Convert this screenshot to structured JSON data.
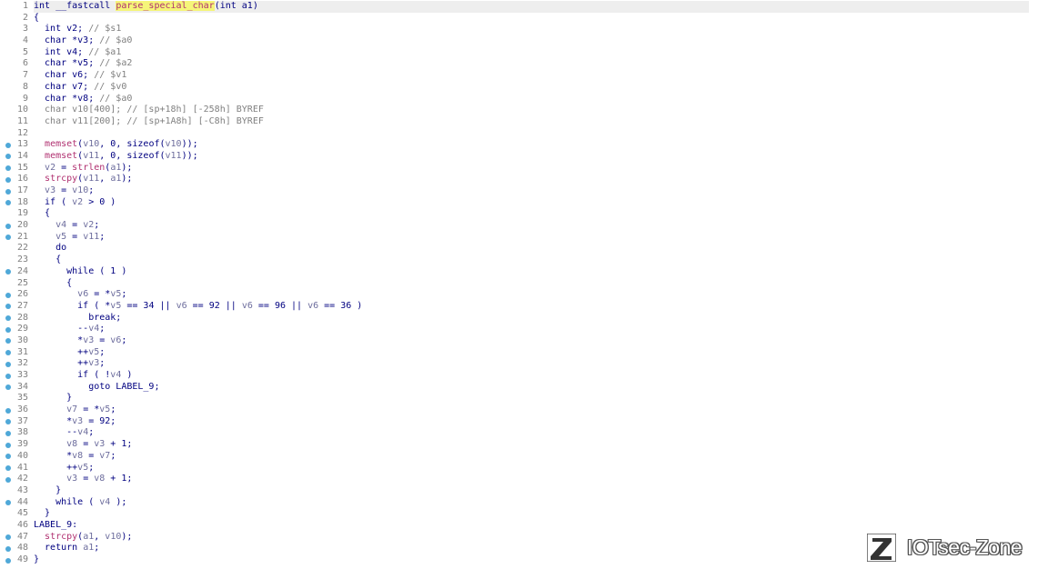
{
  "editor": {
    "lines": [
      {
        "n": "1",
        "bp": false,
        "hl": true,
        "tokens": [
          [
            "plain",
            "int __fastcall "
          ],
          [
            "hlfn",
            "parse_special_char"
          ],
          [
            "plain",
            "(int a1)"
          ]
        ]
      },
      {
        "n": "2",
        "bp": false,
        "tokens": [
          [
            "plain",
            "{"
          ]
        ]
      },
      {
        "n": "3",
        "bp": false,
        "tokens": [
          [
            "plain",
            "  int v2; "
          ],
          [
            "comment",
            "// $s1"
          ]
        ]
      },
      {
        "n": "4",
        "bp": false,
        "tokens": [
          [
            "plain",
            "  char *v3; "
          ],
          [
            "comment",
            "// $a0"
          ]
        ]
      },
      {
        "n": "5",
        "bp": false,
        "tokens": [
          [
            "plain",
            "  int v4; "
          ],
          [
            "comment",
            "// $a1"
          ]
        ]
      },
      {
        "n": "6",
        "bp": false,
        "tokens": [
          [
            "plain",
            "  char *v5; "
          ],
          [
            "comment",
            "// $a2"
          ]
        ]
      },
      {
        "n": "7",
        "bp": false,
        "tokens": [
          [
            "plain",
            "  char v6; "
          ],
          [
            "comment",
            "// $v1"
          ]
        ]
      },
      {
        "n": "8",
        "bp": false,
        "tokens": [
          [
            "plain",
            "  char v7; "
          ],
          [
            "comment",
            "// $v0"
          ]
        ]
      },
      {
        "n": "9",
        "bp": false,
        "tokens": [
          [
            "plain",
            "  char *v8; "
          ],
          [
            "comment",
            "// $a0"
          ]
        ]
      },
      {
        "n": "10",
        "bp": false,
        "tokens": [
          [
            "comment",
            "  char v10[400]; // [sp+18h] [-258h] BYREF"
          ]
        ]
      },
      {
        "n": "11",
        "bp": false,
        "tokens": [
          [
            "comment",
            "  char v11[200]; // [sp+1A8h] [-C8h] BYREF"
          ]
        ]
      },
      {
        "n": "12",
        "bp": false,
        "tokens": [
          [
            "plain",
            ""
          ]
        ]
      },
      {
        "n": "13",
        "bp": true,
        "tokens": [
          [
            "plain",
            "  "
          ],
          [
            "fn",
            "memset"
          ],
          [
            "plain",
            "("
          ],
          [
            "var",
            "v10"
          ],
          [
            "plain",
            ", 0, sizeof("
          ],
          [
            "var",
            "v10"
          ],
          [
            "plain",
            "));"
          ]
        ]
      },
      {
        "n": "14",
        "bp": true,
        "tokens": [
          [
            "plain",
            "  "
          ],
          [
            "fn",
            "memset"
          ],
          [
            "plain",
            "("
          ],
          [
            "var",
            "v11"
          ],
          [
            "plain",
            ", 0, sizeof("
          ],
          [
            "var",
            "v11"
          ],
          [
            "plain",
            "));"
          ]
        ]
      },
      {
        "n": "15",
        "bp": true,
        "tokens": [
          [
            "plain",
            "  "
          ],
          [
            "var",
            "v2"
          ],
          [
            "plain",
            " = "
          ],
          [
            "fn",
            "strlen"
          ],
          [
            "plain",
            "("
          ],
          [
            "var",
            "a1"
          ],
          [
            "plain",
            ");"
          ]
        ]
      },
      {
        "n": "16",
        "bp": true,
        "tokens": [
          [
            "plain",
            "  "
          ],
          [
            "fn",
            "strcpy"
          ],
          [
            "plain",
            "("
          ],
          [
            "var",
            "v11"
          ],
          [
            "plain",
            ", "
          ],
          [
            "var",
            "a1"
          ],
          [
            "plain",
            ");"
          ]
        ]
      },
      {
        "n": "17",
        "bp": true,
        "tokens": [
          [
            "plain",
            "  "
          ],
          [
            "var",
            "v3"
          ],
          [
            "plain",
            " = "
          ],
          [
            "var",
            "v10"
          ],
          [
            "plain",
            ";"
          ]
        ]
      },
      {
        "n": "18",
        "bp": true,
        "tokens": [
          [
            "plain",
            "  if ( "
          ],
          [
            "var",
            "v2"
          ],
          [
            "plain",
            " > 0 )"
          ]
        ]
      },
      {
        "n": "19",
        "bp": false,
        "tokens": [
          [
            "plain",
            "  {"
          ]
        ]
      },
      {
        "n": "20",
        "bp": true,
        "tokens": [
          [
            "plain",
            "    "
          ],
          [
            "var",
            "v4"
          ],
          [
            "plain",
            " = "
          ],
          [
            "var",
            "v2"
          ],
          [
            "plain",
            ";"
          ]
        ]
      },
      {
        "n": "21",
        "bp": true,
        "tokens": [
          [
            "plain",
            "    "
          ],
          [
            "var",
            "v5"
          ],
          [
            "plain",
            " = "
          ],
          [
            "var",
            "v11"
          ],
          [
            "plain",
            ";"
          ]
        ]
      },
      {
        "n": "22",
        "bp": false,
        "tokens": [
          [
            "plain",
            "    do"
          ]
        ]
      },
      {
        "n": "23",
        "bp": false,
        "tokens": [
          [
            "plain",
            "    {"
          ]
        ]
      },
      {
        "n": "24",
        "bp": true,
        "tokens": [
          [
            "plain",
            "      while ( 1 )"
          ]
        ]
      },
      {
        "n": "25",
        "bp": false,
        "tokens": [
          [
            "plain",
            "      {"
          ]
        ]
      },
      {
        "n": "26",
        "bp": true,
        "tokens": [
          [
            "plain",
            "        "
          ],
          [
            "var",
            "v6"
          ],
          [
            "plain",
            " = *"
          ],
          [
            "var",
            "v5"
          ],
          [
            "plain",
            ";"
          ]
        ]
      },
      {
        "n": "27",
        "bp": true,
        "tokens": [
          [
            "plain",
            "        if ( *"
          ],
          [
            "var",
            "v5"
          ],
          [
            "plain",
            " == 34 || "
          ],
          [
            "var",
            "v6"
          ],
          [
            "plain",
            " == 92 || "
          ],
          [
            "var",
            "v6"
          ],
          [
            "plain",
            " == 96 || "
          ],
          [
            "var",
            "v6"
          ],
          [
            "plain",
            " == 36 )"
          ]
        ]
      },
      {
        "n": "28",
        "bp": true,
        "tokens": [
          [
            "plain",
            "          break;"
          ]
        ]
      },
      {
        "n": "29",
        "bp": true,
        "tokens": [
          [
            "plain",
            "        --"
          ],
          [
            "var",
            "v4"
          ],
          [
            "plain",
            ";"
          ]
        ]
      },
      {
        "n": "30",
        "bp": true,
        "tokens": [
          [
            "plain",
            "        *"
          ],
          [
            "var",
            "v3"
          ],
          [
            "plain",
            " = "
          ],
          [
            "var",
            "v6"
          ],
          [
            "plain",
            ";"
          ]
        ]
      },
      {
        "n": "31",
        "bp": true,
        "tokens": [
          [
            "plain",
            "        ++"
          ],
          [
            "var",
            "v5"
          ],
          [
            "plain",
            ";"
          ]
        ]
      },
      {
        "n": "32",
        "bp": true,
        "tokens": [
          [
            "plain",
            "        ++"
          ],
          [
            "var",
            "v3"
          ],
          [
            "plain",
            ";"
          ]
        ]
      },
      {
        "n": "33",
        "bp": true,
        "tokens": [
          [
            "plain",
            "        if ( !"
          ],
          [
            "var",
            "v4"
          ],
          [
            "plain",
            " )"
          ]
        ]
      },
      {
        "n": "34",
        "bp": true,
        "tokens": [
          [
            "plain",
            "          goto LABEL_9;"
          ]
        ]
      },
      {
        "n": "35",
        "bp": false,
        "tokens": [
          [
            "plain",
            "      }"
          ]
        ]
      },
      {
        "n": "36",
        "bp": true,
        "tokens": [
          [
            "plain",
            "      "
          ],
          [
            "var",
            "v7"
          ],
          [
            "plain",
            " = *"
          ],
          [
            "var",
            "v5"
          ],
          [
            "plain",
            ";"
          ]
        ]
      },
      {
        "n": "37",
        "bp": true,
        "tokens": [
          [
            "plain",
            "      *"
          ],
          [
            "var",
            "v3"
          ],
          [
            "plain",
            " = 92;"
          ]
        ]
      },
      {
        "n": "38",
        "bp": true,
        "tokens": [
          [
            "plain",
            "      --"
          ],
          [
            "var",
            "v4"
          ],
          [
            "plain",
            ";"
          ]
        ]
      },
      {
        "n": "39",
        "bp": true,
        "tokens": [
          [
            "plain",
            "      "
          ],
          [
            "var",
            "v8"
          ],
          [
            "plain",
            " = "
          ],
          [
            "var",
            "v3"
          ],
          [
            "plain",
            " + 1;"
          ]
        ]
      },
      {
        "n": "40",
        "bp": true,
        "tokens": [
          [
            "plain",
            "      *"
          ],
          [
            "var",
            "v8"
          ],
          [
            "plain",
            " = "
          ],
          [
            "var",
            "v7"
          ],
          [
            "plain",
            ";"
          ]
        ]
      },
      {
        "n": "41",
        "bp": true,
        "tokens": [
          [
            "plain",
            "      ++"
          ],
          [
            "var",
            "v5"
          ],
          [
            "plain",
            ";"
          ]
        ]
      },
      {
        "n": "42",
        "bp": true,
        "tokens": [
          [
            "plain",
            "      "
          ],
          [
            "var",
            "v3"
          ],
          [
            "plain",
            " = "
          ],
          [
            "var",
            "v8"
          ],
          [
            "plain",
            " + 1;"
          ]
        ]
      },
      {
        "n": "43",
        "bp": false,
        "tokens": [
          [
            "plain",
            "    }"
          ]
        ]
      },
      {
        "n": "44",
        "bp": true,
        "tokens": [
          [
            "plain",
            "    while ( "
          ],
          [
            "var",
            "v4"
          ],
          [
            "plain",
            " );"
          ]
        ]
      },
      {
        "n": "45",
        "bp": false,
        "tokens": [
          [
            "plain",
            "  }"
          ]
        ]
      },
      {
        "n": "46",
        "bp": false,
        "tokens": [
          [
            "plain",
            "LABEL_9:"
          ]
        ]
      },
      {
        "n": "47",
        "bp": true,
        "tokens": [
          [
            "plain",
            "  "
          ],
          [
            "fn",
            "strcpy"
          ],
          [
            "plain",
            "("
          ],
          [
            "var",
            "a1"
          ],
          [
            "plain",
            ", "
          ],
          [
            "var",
            "v10"
          ],
          [
            "plain",
            ");"
          ]
        ]
      },
      {
        "n": "48",
        "bp": true,
        "tokens": [
          [
            "plain",
            "  return "
          ],
          [
            "var",
            "a1"
          ],
          [
            "plain",
            ";"
          ]
        ]
      },
      {
        "n": "49",
        "bp": true,
        "tokens": [
          [
            "plain",
            "}"
          ]
        ]
      }
    ]
  },
  "watermark": {
    "text": "IOTsec-Zone",
    "logo_icon": "z-logo-icon"
  }
}
